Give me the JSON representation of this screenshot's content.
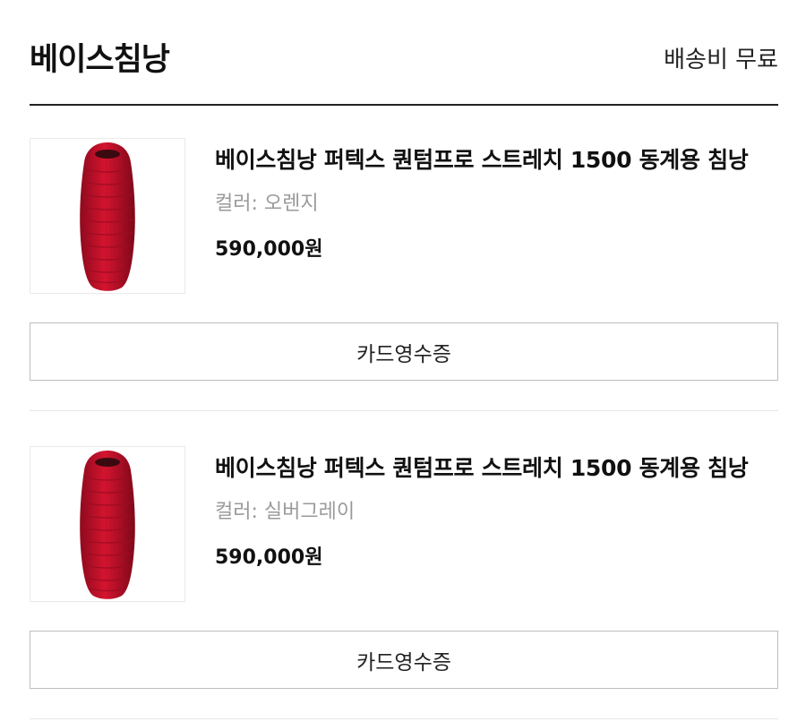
{
  "header": {
    "store_name": "베이스침낭",
    "shipping_label": "배송비 무료"
  },
  "items": [
    {
      "title": "베이스침낭 퍼텍스 퀀텀프로 스트레치 1500 동계용 침낭",
      "option": "컬러: 오렌지",
      "price": "590,000원",
      "receipt_label": "카드영수증",
      "thumbnail_icon": "sleeping-bag-image"
    },
    {
      "title": "베이스침낭 퍼텍스 퀀텀프로 스트레치 1500 동계용 침낭",
      "option": "컬러: 실버그레이",
      "price": "590,000원",
      "receipt_label": "카드영수증",
      "thumbnail_icon": "sleeping-bag-image"
    }
  ],
  "colors": {
    "sleeping_bag_red": "#c8102e",
    "divider": "#222222",
    "muted_text": "#9a9a9a"
  }
}
